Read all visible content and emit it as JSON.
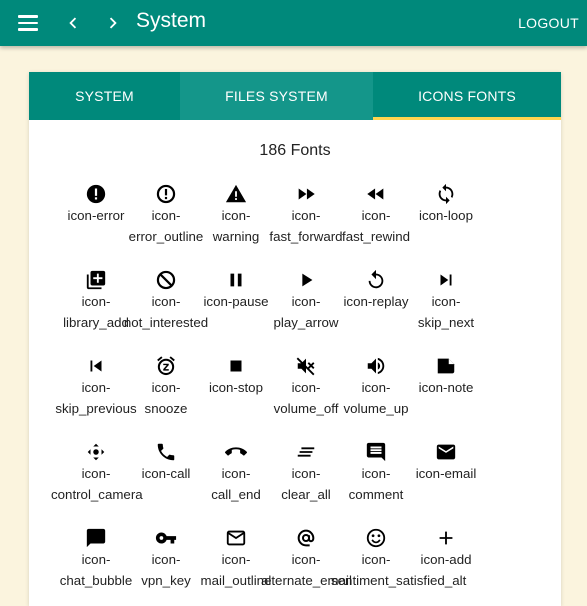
{
  "header": {
    "title": "System",
    "logout_label": "LOGOUT",
    "menu_icon": "menu-icon",
    "back_icon": "chevron-left-icon",
    "forward_icon": "chevron-right-icon"
  },
  "tabs": [
    {
      "label": "SYSTEM",
      "active": false
    },
    {
      "label": "FILES SYSTEM",
      "active": false
    },
    {
      "label": "ICONS FONTS",
      "active": true
    }
  ],
  "colors": {
    "primary": "#00897b",
    "tab_indicator": "#ffd54f",
    "background": "#fbf4de"
  },
  "fonts_count": "186 Fonts",
  "icons": [
    {
      "name": "error",
      "l1": "icon-error",
      "l2": ""
    },
    {
      "name": "error-outline",
      "l1": "icon-",
      "l2": "error_outline"
    },
    {
      "name": "warning",
      "l1": "icon-",
      "l2": "warning"
    },
    {
      "name": "fast-forward",
      "l1": "icon-",
      "l2": "fast_forward"
    },
    {
      "name": "fast-rewind",
      "l1": "icon-",
      "l2": "fast_rewind"
    },
    {
      "name": "loop",
      "l1": "icon-loop",
      "l2": ""
    },
    {
      "name": "library-add",
      "l1": "icon-",
      "l2": "library_add"
    },
    {
      "name": "not-interested",
      "l1": "icon-",
      "l2": "not_interested"
    },
    {
      "name": "pause",
      "l1": "icon-pause",
      "l2": ""
    },
    {
      "name": "play-arrow",
      "l1": "icon-",
      "l2": "play_arrow"
    },
    {
      "name": "replay",
      "l1": "icon-replay",
      "l2": ""
    },
    {
      "name": "skip-next",
      "l1": "icon-",
      "l2": "skip_next"
    },
    {
      "name": "skip-previous",
      "l1": "icon-",
      "l2": "skip_previous"
    },
    {
      "name": "snooze",
      "l1": "icon-",
      "l2": "snooze"
    },
    {
      "name": "stop",
      "l1": "icon-stop",
      "l2": ""
    },
    {
      "name": "volume-off",
      "l1": "icon-",
      "l2": "volume_off"
    },
    {
      "name": "volume-up",
      "l1": "icon-",
      "l2": "volume_up"
    },
    {
      "name": "note",
      "l1": "icon-note",
      "l2": ""
    },
    {
      "name": "control-camera",
      "l1": "icon-",
      "l2": "control_camera"
    },
    {
      "name": "call",
      "l1": "icon-call",
      "l2": ""
    },
    {
      "name": "call-end",
      "l1": "icon-",
      "l2": "call_end"
    },
    {
      "name": "clear-all",
      "l1": "icon-",
      "l2": "clear_all"
    },
    {
      "name": "comment",
      "l1": "icon-",
      "l2": "comment"
    },
    {
      "name": "email",
      "l1": "icon-email",
      "l2": ""
    },
    {
      "name": "chat-bubble",
      "l1": "icon-",
      "l2": "chat_bubble"
    },
    {
      "name": "vpn-key",
      "l1": "icon-",
      "l2": "vpn_key"
    },
    {
      "name": "mail-outline",
      "l1": "icon-",
      "l2": "mail_outline"
    },
    {
      "name": "alternate-email",
      "l1": "icon-",
      "l2": "alternate_email"
    },
    {
      "name": "sentiment-satisfied-alt",
      "l1": "icon-",
      "l2": "sentiment_satisfied_alt"
    },
    {
      "name": "add",
      "l1": "icon-add",
      "l2": ""
    }
  ]
}
